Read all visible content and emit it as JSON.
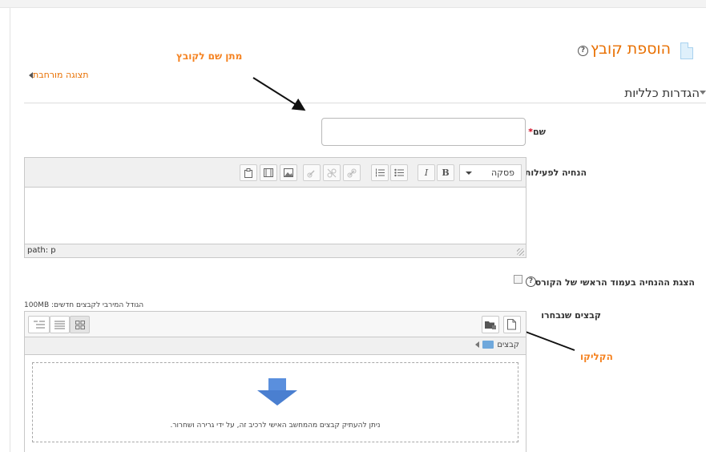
{
  "header": {
    "title": "הוספת קובץ",
    "help_glyph": "?"
  },
  "annotations": {
    "name_hint": "מתן שם לקובץ",
    "click_hint": "הקליקו"
  },
  "links": {
    "expand_view": "תצוגה מורחבת"
  },
  "section": {
    "general_settings": "הגדרות כלליות"
  },
  "form": {
    "name_label": "שם",
    "required_mark": "*",
    "name_value": "",
    "description_label": "הנחיה לפעילות",
    "show_description_label": "הצגת ההנחיה בעמוד הראשי של הקורס",
    "selected_files_label": "קבצים שנבחרו"
  },
  "editor": {
    "format_value": "פסקה",
    "bold_glyph": "B",
    "italic_glyph": "I",
    "path_text": "path: p"
  },
  "file_manager": {
    "max_size_note": "הגודל המירבי לקבצים חדשים: 100MB",
    "path_folder": "קבצים",
    "drop_text": "ניתן להעתיק קבצים מהמחשב האישי לרכיב זה, על ידי גרירה ושחרור."
  },
  "colors": {
    "accent": "#e86f00",
    "annotation": "#f58220",
    "drop_arrow": "#4a86e8"
  }
}
